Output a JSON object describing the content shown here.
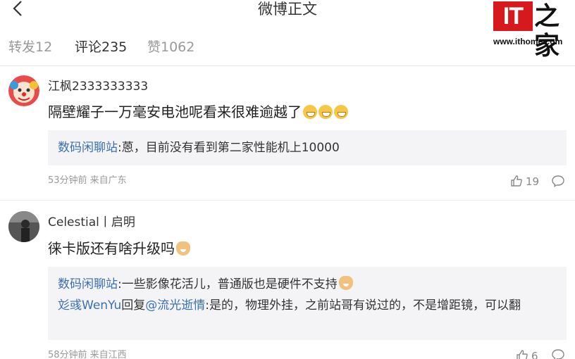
{
  "header": {
    "title": "微博正文"
  },
  "watermark": {
    "logo_text": "IT",
    "logo_char": "之家",
    "url": "www.ithome.com"
  },
  "tabs": [
    {
      "label": "转发12",
      "active": false
    },
    {
      "label": "评论235",
      "active": true
    },
    {
      "label": "赞1062",
      "active": false
    }
  ],
  "comments": [
    {
      "username": "江枫2333333333",
      "text": "隔壁耀子一万毫安电池呢看来很难逾越了",
      "emojis": [
        "grin-emoji",
        "grin-emoji",
        "grin-emoji"
      ],
      "replies": [
        {
          "author": "数码闲聊站",
          "text": ":蒽，目前没有看到第二家性能机上10000"
        }
      ],
      "time_location": "53分钟前 来自广东",
      "likes": "19"
    },
    {
      "username": "Celestial丨启明",
      "text": "徕卡版还有啥升级吗",
      "emojis": [
        "doge-emoji"
      ],
      "replies": [
        {
          "author": "数码闲聊站",
          "text": ":一些影像花活儿，普通版也是硬件不支持"
        },
        {
          "author": "彣彧WenYu",
          "mid": "回复",
          "mention": "@流光逝情",
          "text": ":是的，物理外挂，之前站哥有说过的，不是增距镜，可以翻"
        }
      ],
      "time_location": "58分钟前 来自江西",
      "likes": "6"
    }
  ],
  "colors": {
    "link": "#3a6fb0",
    "brand_red": "#d7191d"
  }
}
